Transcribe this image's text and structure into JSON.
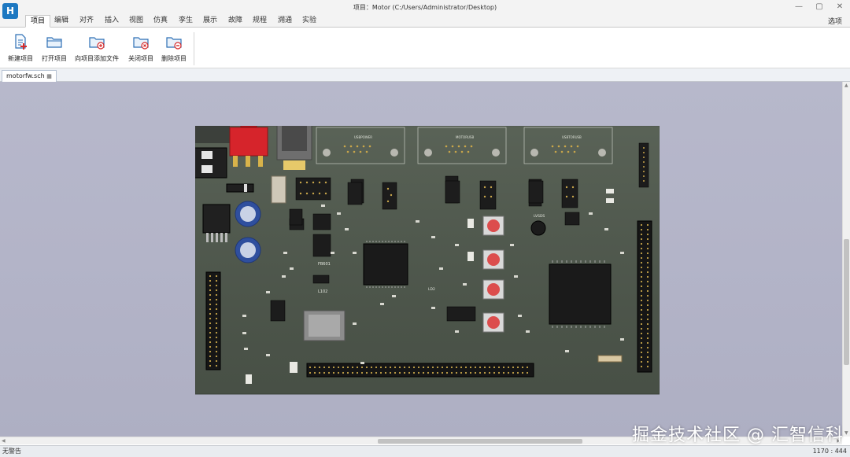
{
  "app": {
    "logo_text": "H",
    "window_title": "项目：Motor (C:/Users/Administrator/Desktop)",
    "window_controls": [
      "—",
      "▢",
      "✕"
    ]
  },
  "ribbon": {
    "tabs": [
      {
        "label": "项目",
        "active": true
      },
      {
        "label": "编辑"
      },
      {
        "label": "对齐"
      },
      {
        "label": "插入"
      },
      {
        "label": "视图"
      },
      {
        "label": "仿真"
      },
      {
        "label": "孪生"
      },
      {
        "label": "展示"
      },
      {
        "label": "故障"
      },
      {
        "label": "规程"
      },
      {
        "label": "溯通"
      },
      {
        "label": "实验"
      }
    ],
    "options_label": "选项",
    "buttons": [
      {
        "label": "新建项目",
        "icon": "new-project-icon"
      },
      {
        "label": "打开项目",
        "icon": "open-folder-icon"
      },
      {
        "label": "向项目添加文件",
        "icon": "add-file-to-project-icon"
      },
      {
        "label": "关闭项目",
        "icon": "close-project-icon"
      },
      {
        "label": "删除项目",
        "icon": "delete-project-icon"
      }
    ]
  },
  "document": {
    "tab_label": "motorfw.sch",
    "tab_icon": "grid-icon"
  },
  "pcb": {
    "labels": {
      "usb1": "USBPOWER",
      "usb2": "MOTORUSB",
      "usb3": "USBTORUSB",
      "fb601": "FB601",
      "l102": "L102",
      "ld2": "LD2",
      "ledlabel": "LVSDS"
    }
  },
  "colors": {
    "accent": "#1d78c1",
    "board": "#50594e",
    "viewport_bg": "#b4b5c9"
  },
  "status": {
    "left": "无警告",
    "right": "1170 : 444"
  },
  "watermark": "掘金技术社区 @ 汇智信科"
}
